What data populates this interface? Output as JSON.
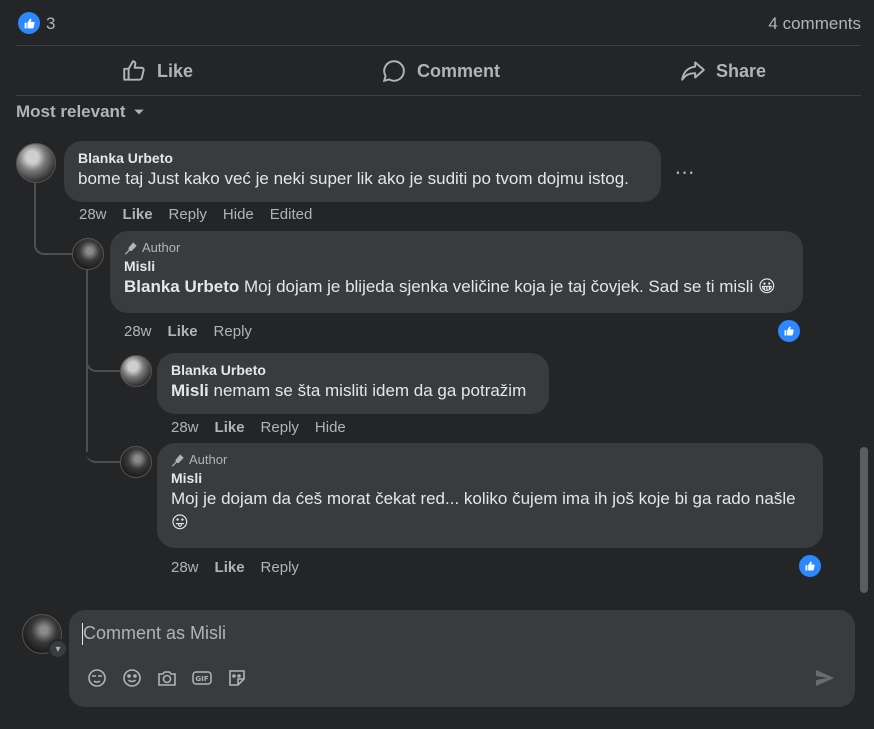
{
  "summary": {
    "reaction_count": "3",
    "comments_count": "4 comments"
  },
  "actions": {
    "like": "Like",
    "comment": "Comment",
    "share": "Share"
  },
  "sort": {
    "label": "Most relevant"
  },
  "comments": [
    {
      "name": "Blanka Urbeto",
      "text": "bome taj Just kako već je neki super lik ako je suditi po tvom dojmu istog.",
      "time": "28w",
      "actions": [
        "Like",
        "Reply",
        "Hide",
        "Edited"
      ]
    },
    {
      "badge": "Author",
      "name": "Misli",
      "mention": "Blanka Urbeto",
      "text": " Moj dojam je blijeda sjenka veličine koja je taj čovjek. Sad se ti misli 😀",
      "time": "28w",
      "actions": [
        "Like",
        "Reply"
      ]
    },
    {
      "name": "Blanka Urbeto",
      "mention": "Misli",
      "text": " nemam se šta misliti idem da ga potražim",
      "time": "28w",
      "actions": [
        "Like",
        "Reply",
        "Hide"
      ]
    },
    {
      "badge": "Author",
      "name": "Misli",
      "text": "Moj je dojam da ćeš morat čekat red... koliko čujem ima ih još koje bi ga rado našle 😛",
      "time": "28w",
      "actions": [
        "Like",
        "Reply"
      ]
    }
  ],
  "composer": {
    "placeholder": "Comment as Misli"
  },
  "colors": {
    "background": "#242526",
    "bubble": "#3a3b3c",
    "accent": "#2d88ff",
    "text": "#e4e6eb",
    "muted": "#b0b3b8"
  }
}
